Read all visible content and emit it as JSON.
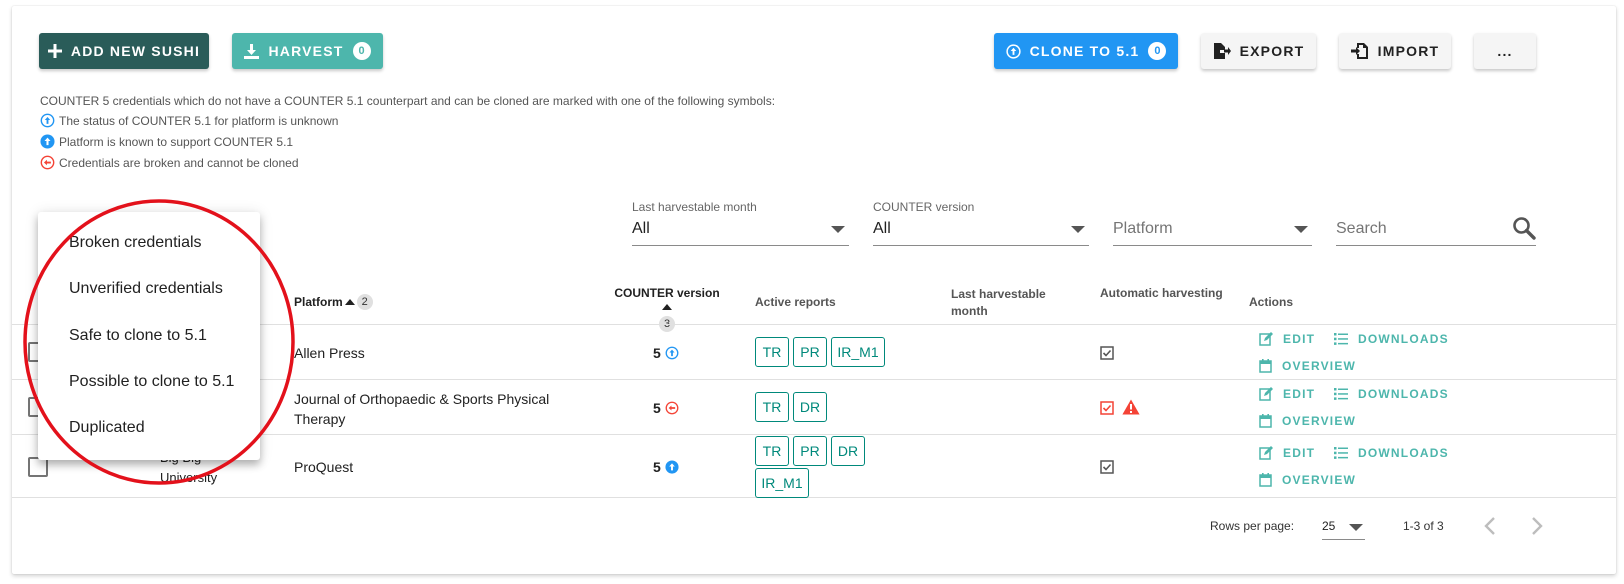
{
  "toolbar": {
    "add_new": "ADD NEW SUSHI",
    "harvest": "HARVEST",
    "harvest_count": "0",
    "clone": "CLONE TO 5.1",
    "clone_count": "0",
    "export": "EXPORT",
    "import": "IMPORT",
    "more": "..."
  },
  "legend": {
    "intro": "COUNTER 5 credentials which do not have a COUNTER 5.1 counterpart and can be cloned are marked with one of the following symbols:",
    "unknown": "The status of COUNTER 5.1 for platform is unknown",
    "supported": "Platform is known to support COUNTER 5.1",
    "broken": "Credentials are broken and cannot be cloned"
  },
  "filters": {
    "last_month_label": "Last harvestable month",
    "last_month_value": "All",
    "counter_label": "COUNTER version",
    "counter_value": "All",
    "platform_placeholder": "Platform",
    "search_placeholder": "Search"
  },
  "table": {
    "headers": {
      "platform": "Platform",
      "platform_sort": "2",
      "counter_version": "COUNTER version",
      "counter_sort": "3",
      "active_reports": "Active reports",
      "last_harvestable": "Last harvestable month",
      "automatic": "Automatic harvesting",
      "actions": "Actions"
    },
    "rows": [
      {
        "org": "",
        "platform": "Allen Press",
        "version": "5",
        "status": "unknown",
        "reports": [
          "TR",
          "PR",
          "IR_M1"
        ],
        "auto_error": false
      },
      {
        "org": "",
        "platform": "Journal of Orthopaedic & Sports Physical Therapy",
        "version": "5",
        "status": "broken",
        "reports": [
          "TR",
          "DR"
        ],
        "auto_error": true
      },
      {
        "org": "Big Big University",
        "platform": "ProQuest",
        "version": "5",
        "status": "supported",
        "reports": [
          "TR",
          "PR",
          "DR",
          "IR_M1"
        ],
        "auto_error": false
      }
    ],
    "actions": {
      "edit": "EDIT",
      "downloads": "DOWNLOADS",
      "overview": "OVERVIEW"
    }
  },
  "footer": {
    "rows_per_page_label": "Rows per page:",
    "rows_per_page": "25",
    "range": "1-3 of 3"
  },
  "menu": {
    "items": [
      "Broken credentials",
      "Unverified credentials",
      "Safe to clone to 5.1",
      "Possible to clone to 5.1",
      "Duplicated"
    ]
  },
  "colors": {
    "primary_dark": "#2a5c59",
    "teal": "#4db6ac",
    "blue": "#2196f3",
    "chip": "#00897b",
    "error": "#f44336",
    "annotation": "#e3111b"
  }
}
